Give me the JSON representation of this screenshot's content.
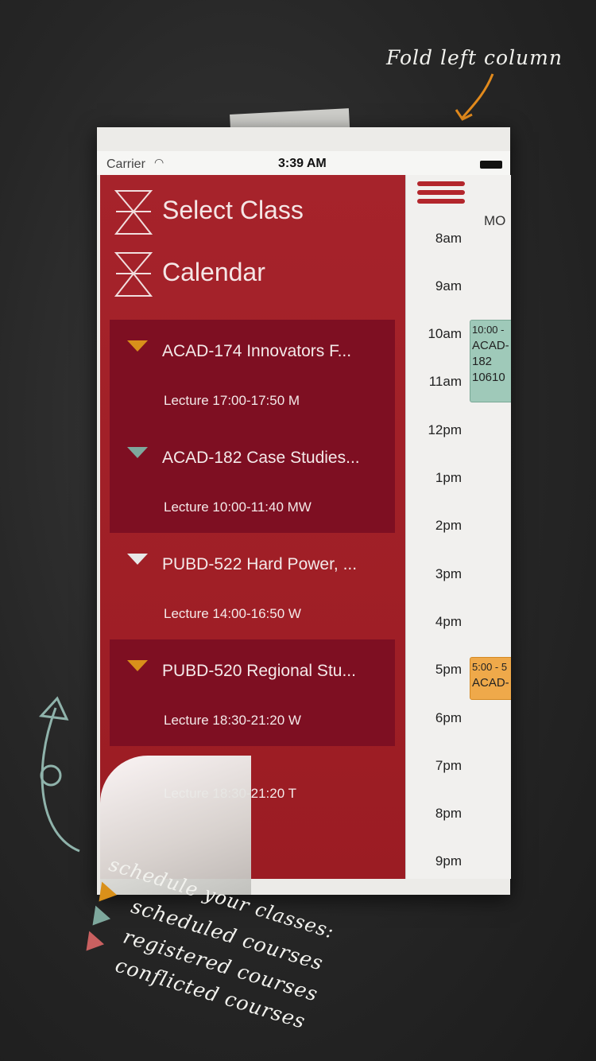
{
  "annotation": {
    "fold_note": "Fold left column"
  },
  "status_bar": {
    "carrier": "Carrier",
    "time": "3:39 AM"
  },
  "menu": {
    "select_class": "Select Class",
    "calendar": "Calendar"
  },
  "courses": [
    {
      "title": "ACAD-174 Innovators F...",
      "lecture": "Lecture 17:00-17:50 M",
      "marker_color": "#d9901a"
    },
    {
      "title": "ACAD-182 Case Studies...",
      "lecture": "Lecture 10:00-11:40 MW",
      "marker_color": "#7ea89d"
    },
    {
      "title": "PUBD-522 Hard Power, ...",
      "lecture": "Lecture 14:00-16:50 W",
      "marker_color": "#e8e8e8"
    },
    {
      "title": "PUBD-520 Regional Stu...",
      "lecture": "Lecture 18:30-21:20 W",
      "marker_color": "#d9901a"
    },
    {
      "title": "",
      "lecture": "Lecture 18:30-21:20 T",
      "marker_color": ""
    }
  ],
  "calendar": {
    "day": "MO",
    "hours": [
      "8am",
      "9am",
      "10am",
      "11am",
      "12pm",
      "1pm",
      "2pm",
      "3pm",
      "4pm",
      "5pm",
      "6pm",
      "7pm",
      "8pm",
      "9pm"
    ],
    "events": [
      {
        "time": "10:00 -",
        "line1": "ACAD-",
        "line2": "182",
        "line3": "10610"
      },
      {
        "time": "5:00 - 5",
        "line1": "ACAD-",
        "line2": "",
        "line3": ""
      }
    ]
  },
  "legend": {
    "title": "schedule your classes:",
    "items": [
      "scheduled courses",
      "registered courses",
      "conflicted courses"
    ]
  },
  "colors": {
    "sidebar_red": "#a6232b",
    "course_dark": "#7e0f22",
    "scheduled": "#d9901a",
    "registered": "#7ea89d",
    "conflicted": "#c96060"
  }
}
